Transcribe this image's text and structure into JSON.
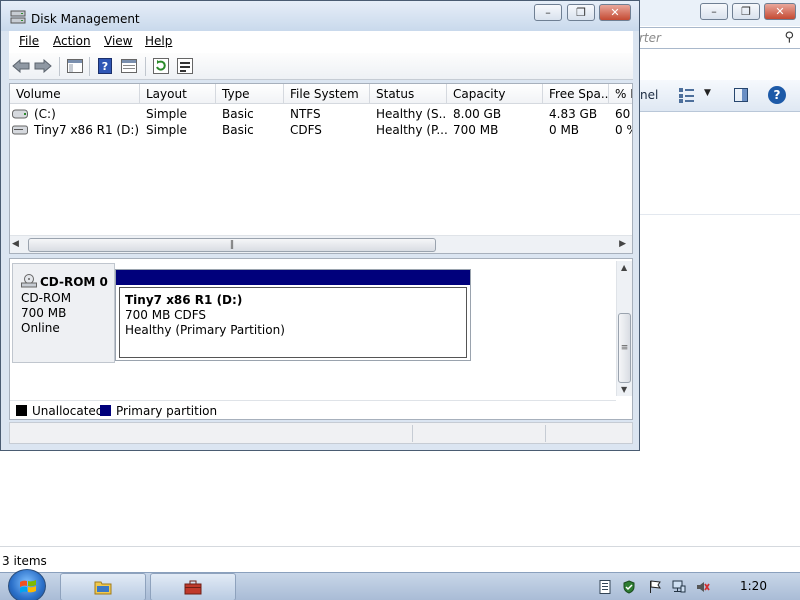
{
  "background_window": {
    "search_placeholder": "rter",
    "command_text": "nel",
    "status_text": "3 items"
  },
  "dm_window": {
    "title": "Disk Management",
    "menu": [
      "File",
      "Action",
      "View",
      "Help"
    ],
    "columns": [
      "Volume",
      "Layout",
      "Type",
      "File System",
      "Status",
      "Capacity",
      "Free Spa...",
      "% F"
    ],
    "volumes": [
      {
        "volume": "(C:)",
        "layout": "Simple",
        "type": "Basic",
        "fs": "NTFS",
        "status": "Healthy (S...",
        "capacity": "8.00 GB",
        "free": "4.83 GB",
        "pct": "60"
      },
      {
        "volume": "Tiny7 x86 R1 (D:)",
        "layout": "Simple",
        "type": "Basic",
        "fs": "CDFS",
        "status": "Healthy (P...",
        "capacity": "700 MB",
        "free": "0 MB",
        "pct": "0 %"
      }
    ],
    "disk": {
      "name": "CD-ROM 0",
      "type": "CD-ROM",
      "size": "700 MB",
      "state": "Online"
    },
    "partition": {
      "name": "Tiny7 x86 R1  (D:)",
      "size_fs": "700 MB CDFS",
      "status": "Healthy (Primary Partition)"
    },
    "legend": [
      "Unallocated",
      "Primary partition"
    ]
  },
  "taskbar": {
    "clock": "1:20"
  },
  "colors": {
    "primary_partition": "#00007b",
    "unallocated": "#000000",
    "window_frame": "#dbe5f1"
  }
}
